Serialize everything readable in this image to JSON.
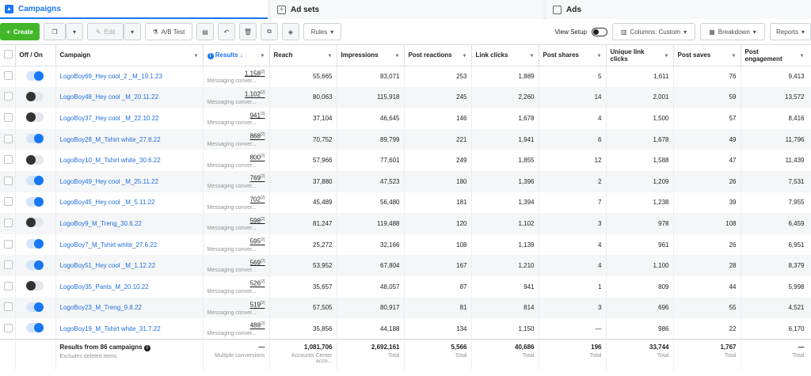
{
  "tabs": {
    "campaigns": "Campaigns",
    "adsets": "Ad sets",
    "ads": "Ads"
  },
  "toolbar": {
    "create": "Create",
    "edit": "Edit",
    "ab_test": "A/B Test",
    "rules": "Rules",
    "view_setup": "View Setup",
    "columns": "Columns: Custom",
    "breakdown": "Breakdown",
    "reports": "Reports"
  },
  "columns": {
    "offon": "Off / On",
    "campaign": "Campaign",
    "results": "Results",
    "reach": "Reach",
    "impressions": "Impressions",
    "post_reactions": "Post reactions",
    "link_clicks": "Link clicks",
    "post_shares": "Post shares",
    "unique_link_clicks": "Unique link clicks",
    "post_saves": "Post saves",
    "post_engagement": "Post engagement"
  },
  "result_sub": "Messaging conver...",
  "rows": [
    {
      "on": true,
      "name": "LogoBoy69_Hey cool_2 _M_19.1.23",
      "results": "1,158",
      "reach": "55,665",
      "impressions": "83,071",
      "reactions": "253",
      "clicks": "1,889",
      "shares": "5",
      "unique": "1,611",
      "saves": "76",
      "engagement": "9,413"
    },
    {
      "on": false,
      "name": "LogoBoy48_Hey cool _M_20.11.22",
      "results": "1,102",
      "reach": "80,063",
      "impressions": "115,918",
      "reactions": "245",
      "clicks": "2,260",
      "shares": "14",
      "unique": "2,001",
      "saves": "59",
      "engagement": "13,572"
    },
    {
      "on": false,
      "name": "LogoBoy37_Hey cool _M_22.10.22",
      "results": "941",
      "reach": "37,104",
      "impressions": "46,645",
      "reactions": "146",
      "clicks": "1,678",
      "shares": "4",
      "unique": "1,500",
      "saves": "57",
      "engagement": "8,416"
    },
    {
      "on": true,
      "name": "LogoBoy28_M_Tshirt white_27.8.22",
      "results": "868",
      "reach": "70,752",
      "impressions": "89,799",
      "reactions": "221",
      "clicks": "1,941",
      "shares": "6",
      "unique": "1,678",
      "saves": "49",
      "engagement": "11,796"
    },
    {
      "on": false,
      "name": "LogoBoy10_M_Tshirt white_30.6.22",
      "results": "800",
      "reach": "57,966",
      "impressions": "77,601",
      "reactions": "249",
      "clicks": "1,855",
      "shares": "12",
      "unique": "1,588",
      "saves": "47",
      "engagement": "11,439"
    },
    {
      "on": true,
      "name": "LogoBoy49_Hey cool _M_25.11.22",
      "results": "769",
      "reach": "37,880",
      "impressions": "47,523",
      "reactions": "180",
      "clicks": "1,396",
      "shares": "2",
      "unique": "1,209",
      "saves": "26",
      "engagement": "7,531"
    },
    {
      "on": true,
      "name": "LogoBoy45_Hey cool _M_5.11.22",
      "results": "702",
      "reach": "45,489",
      "impressions": "56,480",
      "reactions": "181",
      "clicks": "1,394",
      "shares": "7",
      "unique": "1,238",
      "saves": "39",
      "engagement": "7,955"
    },
    {
      "on": false,
      "name": "LogoBoy9_M_Treng_30.6.22",
      "results": "598",
      "reach": "81,247",
      "impressions": "119,488",
      "reactions": "120",
      "clicks": "1,102",
      "shares": "3",
      "unique": "978",
      "saves": "108",
      "engagement": "6,459"
    },
    {
      "on": true,
      "name": "LogoBoy7_M_Tshirt white_27.6.22",
      "results": "595",
      "reach": "25,272",
      "impressions": "32,166",
      "reactions": "108",
      "clicks": "1,139",
      "shares": "4",
      "unique": "961",
      "saves": "26",
      "engagement": "6,951"
    },
    {
      "on": true,
      "name": "LogoBoy51_Hey cool _M_1.12.22",
      "results": "569",
      "reach": "53,952",
      "impressions": "67,804",
      "reactions": "167",
      "clicks": "1,210",
      "shares": "4",
      "unique": "1,100",
      "saves": "28",
      "engagement": "8,379"
    },
    {
      "on": false,
      "name": "LogoBoy35_Pants_M_20.10.22",
      "results": "526",
      "reach": "35,657",
      "impressions": "48,057",
      "reactions": "87",
      "clicks": "941",
      "shares": "1",
      "unique": "809",
      "saves": "44",
      "engagement": "5,998"
    },
    {
      "on": true,
      "name": "LogoBoy23_M_Treng_9.8.22",
      "results": "519",
      "reach": "57,505",
      "impressions": "80,917",
      "reactions": "81",
      "clicks": "814",
      "shares": "3",
      "unique": "696",
      "saves": "55",
      "engagement": "4,521"
    },
    {
      "on": true,
      "name": "LogoBoy19_M_Tshirt white_31.7.22",
      "results": "488",
      "reach": "35,856",
      "impressions": "44,188",
      "reactions": "134",
      "clicks": "1,150",
      "shares": "—",
      "unique": "986",
      "saves": "22",
      "engagement": "6,170"
    }
  ],
  "totals": {
    "label": "Results from 86 campaigns",
    "label_sub": "Excludes deleted items",
    "results": "—",
    "results_sub": "Multiple conversions",
    "reach": "1,081,706",
    "reach_sub": "Accounts Center acco...",
    "impressions": "2,692,161",
    "reactions": "5,566",
    "clicks": "40,686",
    "shares": "196",
    "unique": "33,744",
    "saves": "1,767",
    "engagement": "—",
    "total_sub": "Total"
  }
}
